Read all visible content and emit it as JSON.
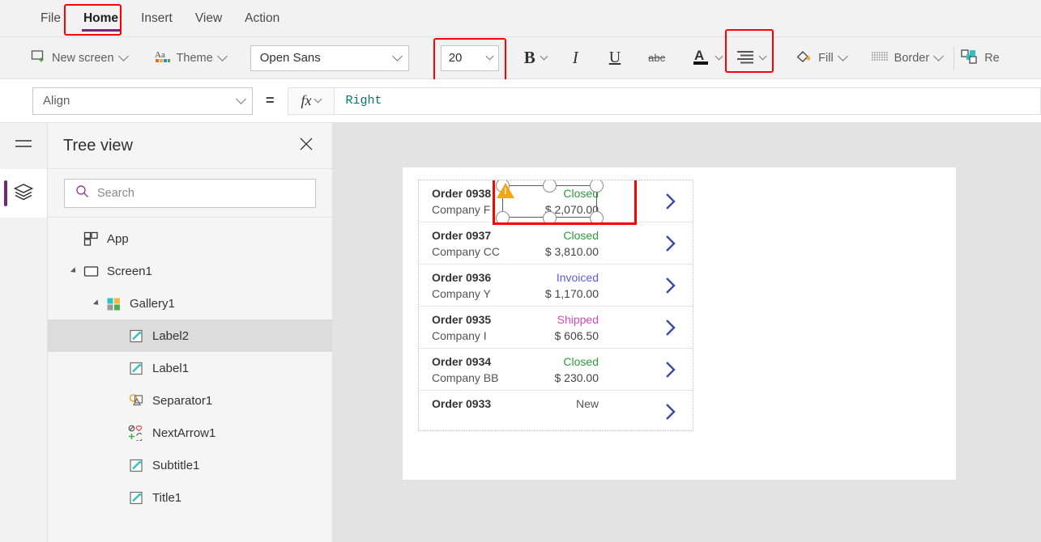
{
  "menubar": {
    "items": [
      {
        "label": "File",
        "active": false
      },
      {
        "label": "Home",
        "active": true
      },
      {
        "label": "Insert",
        "active": false
      },
      {
        "label": "View",
        "active": false
      },
      {
        "label": "Action",
        "active": false
      }
    ]
  },
  "ribbon": {
    "new_screen": "New screen",
    "theme": "Theme",
    "font_family_value": "Open Sans",
    "font_size_value": "20",
    "bold": "B",
    "italic": "I",
    "underline": "U",
    "strikethrough": "abc",
    "font_color": "A",
    "fill": "Fill",
    "border": "Border",
    "reorder": "Re"
  },
  "formula_bar": {
    "property_value": "Align",
    "equals": "=",
    "fx": "fx",
    "formula_value": "Right"
  },
  "tree": {
    "title": "Tree view",
    "close_icon": "close-icon",
    "search_placeholder": "Search",
    "nodes": [
      {
        "label": "App",
        "icon": "app-icon",
        "indent": 0,
        "expander": false,
        "selected": false
      },
      {
        "label": "Screen1",
        "icon": "screen-icon",
        "indent": 0,
        "expander": true,
        "selected": false
      },
      {
        "label": "Gallery1",
        "icon": "gallery-icon",
        "indent": 1,
        "expander": true,
        "selected": false
      },
      {
        "label": "Label2",
        "icon": "label-icon",
        "indent": 2,
        "expander": false,
        "selected": true
      },
      {
        "label": "Label1",
        "icon": "label-icon",
        "indent": 2,
        "expander": false,
        "selected": false
      },
      {
        "label": "Separator1",
        "icon": "separator-icon",
        "indent": 2,
        "expander": false,
        "selected": false
      },
      {
        "label": "NextArrow1",
        "icon": "icon-control-icon",
        "indent": 2,
        "expander": false,
        "selected": false
      },
      {
        "label": "Subtitle1",
        "icon": "label-icon",
        "indent": 2,
        "expander": false,
        "selected": false
      },
      {
        "label": "Title1",
        "icon": "label-icon",
        "indent": 2,
        "expander": false,
        "selected": false
      }
    ]
  },
  "rail": {
    "hamburger_icon": "hamburger-icon",
    "tree_view_icon": "layers-icon"
  },
  "canvas": {
    "gallery": {
      "rows": [
        {
          "title": "Order 0938",
          "subtitle": "Company F",
          "status": "Closed",
          "status_color": "#2e9b3d",
          "amount": "$ 2,070.00",
          "selected": true
        },
        {
          "title": "Order 0937",
          "subtitle": "Company CC",
          "status": "Closed",
          "status_color": "#2e9b3d",
          "amount": "$ 3,810.00",
          "selected": false
        },
        {
          "title": "Order 0936",
          "subtitle": "Company Y",
          "status": "Invoiced",
          "status_color": "#5c5cd6",
          "amount": "$ 1,170.00",
          "selected": false
        },
        {
          "title": "Order 0935",
          "subtitle": "Company I",
          "status": "Shipped",
          "status_color": "#cf4ab3",
          "amount": "$ 606.50",
          "selected": false
        },
        {
          "title": "Order 0934",
          "subtitle": "Company BB",
          "status": "Closed",
          "status_color": "#2e9b3d",
          "amount": "$ 230.00",
          "selected": false
        },
        {
          "title": "Order 0933",
          "subtitle": "",
          "status": "New",
          "status_color": "#555555",
          "amount": "",
          "selected": false
        }
      ],
      "chevron_icon": "chevron-right-icon",
      "warning_icon": "warning-triangle-icon",
      "warning_glyph": "!"
    }
  },
  "colors": {
    "accent_purple": "#742774",
    "annotation_red": "#ff0000",
    "formula_text": "#0b7272"
  }
}
